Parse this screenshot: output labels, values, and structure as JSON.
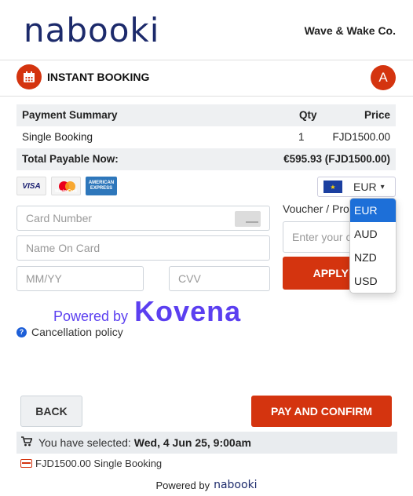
{
  "header": {
    "logo_text": "nabooki",
    "company": "Wave & Wake Co."
  },
  "booking_bar": {
    "title": "INSTANT BOOKING",
    "avatar_initial": "A"
  },
  "summary": {
    "headers": [
      "Payment Summary",
      "Qty",
      "Price"
    ],
    "rows": [
      [
        "Single Booking",
        "1",
        "FJD1500.00"
      ]
    ],
    "total_label": "Total Payable Now:",
    "total_value": "€595.93 (FJD1500.00)"
  },
  "payment_cards": [
    "VISA",
    "MasterCard",
    "AMERICAN EXPRESS"
  ],
  "currency": {
    "selected": "EUR",
    "options": [
      "EUR",
      "AUD",
      "NZD",
      "USD"
    ]
  },
  "form": {
    "card_number_placeholder": "Card Number",
    "name_placeholder": "Name On Card",
    "expiry_placeholder": "MM/YY",
    "cvv_placeholder": "CVV",
    "voucher_label": "Voucher / Promo",
    "voucher_placeholder": "Enter your code",
    "apply_label": "APPLY"
  },
  "powered": {
    "prefix": "Powered by",
    "brand": "Kovena"
  },
  "cancellation_label": "Cancellation policy",
  "buttons": {
    "back": "BACK",
    "pay": "PAY AND CONFIRM"
  },
  "selection": {
    "prefix": "You have selected:",
    "value": "Wed, 4 Jun 25, 9:00am"
  },
  "booking_line": "FJD1500.00 Single Booking",
  "footer": {
    "prefix": "Powered by",
    "brand": "nabooki"
  },
  "colors": {
    "accent": "#d4340f",
    "brand_navy": "#1c2a6b",
    "kovena": "#5b3ff0",
    "selected_option": "#1d6fd8"
  }
}
